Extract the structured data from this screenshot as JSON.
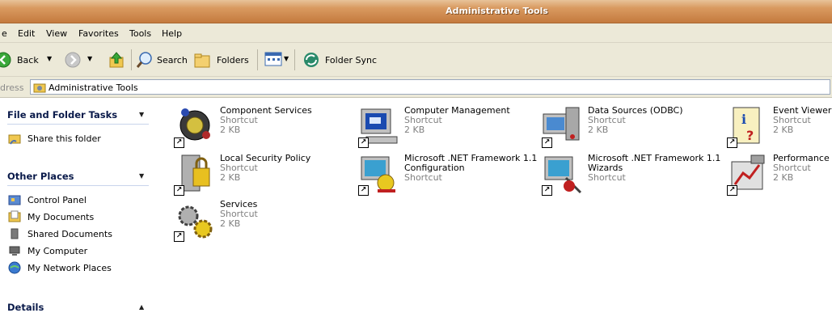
{
  "window": {
    "title": "Administrative Tools"
  },
  "menu": [
    "e",
    "Edit",
    "View",
    "Favorites",
    "Tools",
    "Help"
  ],
  "toolbar": {
    "back": "Back",
    "search": "Search",
    "folders": "Folders",
    "folder_sync": "Folder Sync"
  },
  "address": {
    "label": "dress",
    "value": "Administrative Tools"
  },
  "tasks": {
    "file_folder": {
      "title": "File and Folder Tasks",
      "items": [
        "Share this folder"
      ]
    },
    "other_places": {
      "title": "Other Places",
      "items": [
        "Control Panel",
        "My Documents",
        "Shared Documents",
        "My Computer",
        "My Network Places"
      ]
    },
    "details": {
      "title": "Details"
    }
  },
  "items": [
    {
      "name": "Component Services",
      "type": "Shortcut",
      "size": "2 KB",
      "icon": "component-services-icon"
    },
    {
      "name": "Computer Management",
      "type": "Shortcut",
      "size": "2 KB",
      "icon": "computer-management-icon"
    },
    {
      "name": "Data Sources (ODBC)",
      "type": "Shortcut",
      "size": "2 KB",
      "icon": "data-sources-icon"
    },
    {
      "name": "Event Viewer",
      "type": "Shortcut",
      "size": "2 KB",
      "icon": "event-viewer-icon"
    },
    {
      "name": "Local Security Policy",
      "type": "Shortcut",
      "size": "2 KB",
      "icon": "local-security-policy-icon"
    },
    {
      "name": "Microsoft .NET Framework 1.1",
      "name2": "Configuration",
      "type": "Shortcut",
      "icon": "net-config-icon"
    },
    {
      "name": "Microsoft .NET Framework 1.1",
      "name2": "Wizards",
      "type": "Shortcut",
      "icon": "net-wizards-icon"
    },
    {
      "name": "Performance",
      "type": "Shortcut",
      "size": "2 KB",
      "icon": "performance-icon"
    },
    {
      "name": "Services",
      "type": "Shortcut",
      "size": "2 KB",
      "icon": "services-icon"
    }
  ]
}
